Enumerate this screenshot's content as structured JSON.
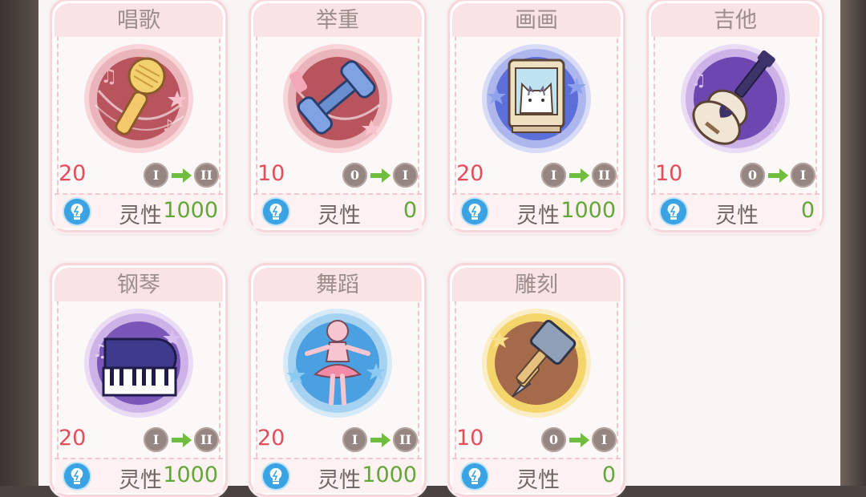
{
  "cards": [
    {
      "name": "唱歌",
      "level": "20",
      "from": "I",
      "to": "II",
      "stat_label": "灵性",
      "stat_value": "1000",
      "medal": "microphone-icon"
    },
    {
      "name": "举重",
      "level": "10",
      "from": "0",
      "to": "I",
      "stat_label": "灵性",
      "stat_value": "0",
      "medal": "dumbbell-icon"
    },
    {
      "name": "画画",
      "level": "20",
      "from": "I",
      "to": "II",
      "stat_label": "灵性",
      "stat_value": "1000",
      "medal": "easel-cat-icon"
    },
    {
      "name": "吉他",
      "level": "10",
      "from": "0",
      "to": "I",
      "stat_label": "灵性",
      "stat_value": "0",
      "medal": "guitar-icon"
    },
    {
      "name": "钢琴",
      "level": "20",
      "from": "I",
      "to": "II",
      "stat_label": "灵性",
      "stat_value": "1000",
      "medal": "piano-icon"
    },
    {
      "name": "舞蹈",
      "level": "20",
      "from": "I",
      "to": "II",
      "stat_label": "灵性",
      "stat_value": "1000",
      "medal": "ballerina-icon"
    },
    {
      "name": "雕刻",
      "level": "10",
      "from": "0",
      "to": "I",
      "stat_label": "灵性",
      "stat_value": "0",
      "medal": "hammer-chisel-icon"
    }
  ],
  "colors": {
    "level": "#e44d5a",
    "stat_value": "#63a63a",
    "badge": "#958681",
    "arrow": "#6fbe3f",
    "bulb": "#3aa3e4"
  }
}
